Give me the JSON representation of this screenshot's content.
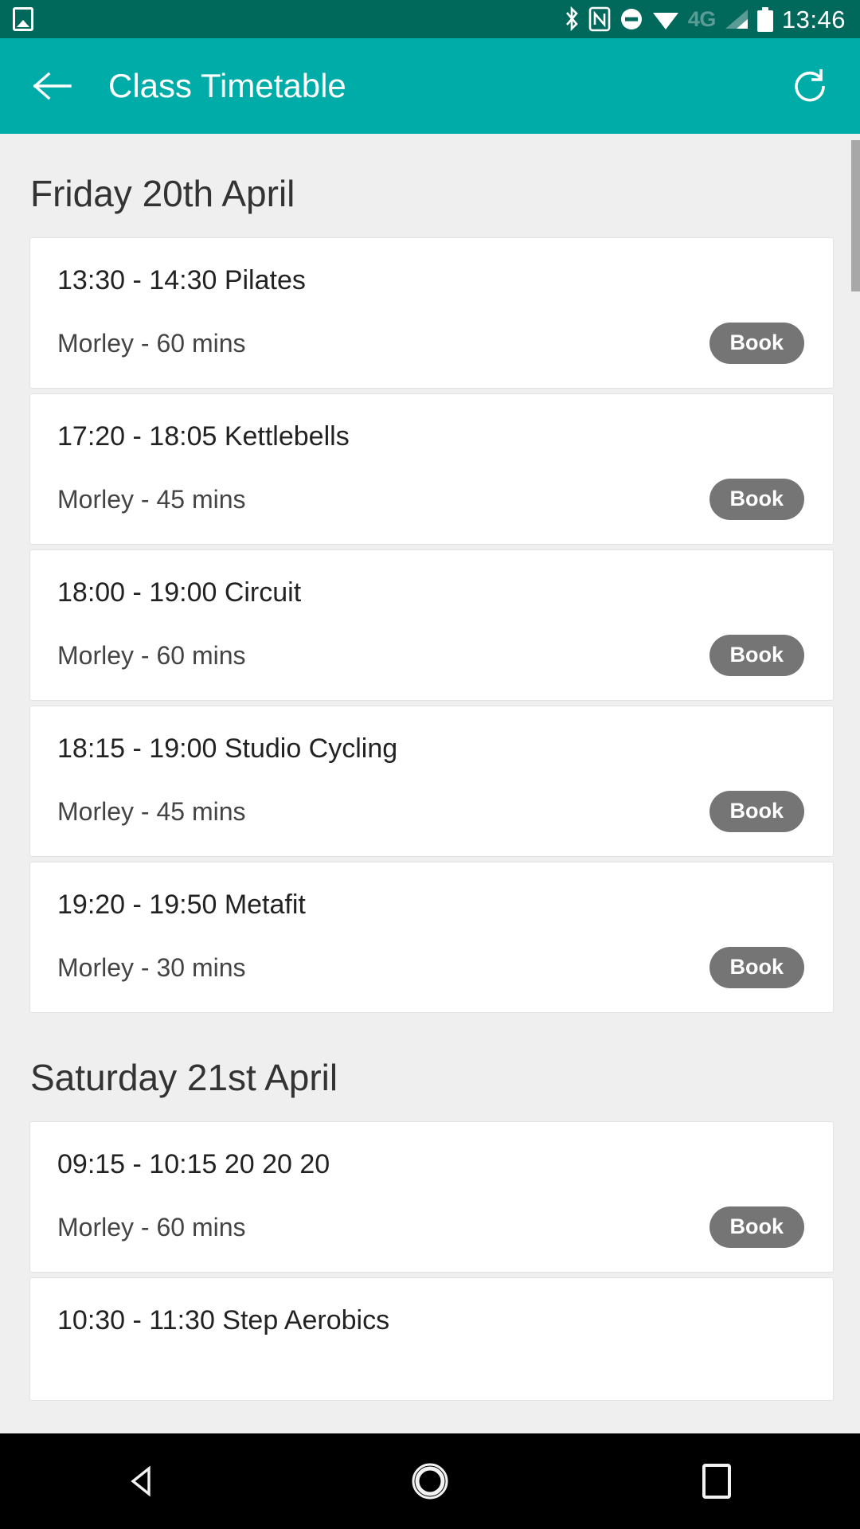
{
  "status_bar": {
    "background": "#00695C",
    "left_icons": [
      "photo-icon"
    ],
    "right_icons": [
      "bluetooth-icon",
      "nfc-icon",
      "do-not-disturb-icon",
      "wifi-icon"
    ],
    "network_label": "4G",
    "time": "13:46"
  },
  "app_bar": {
    "background": "#00ACA7",
    "back_label": "Back",
    "title": "Class Timetable",
    "refresh_label": "Refresh"
  },
  "book_button_color": "#757575",
  "sections": [
    {
      "date": "Friday 20th April",
      "classes": [
        {
          "title": "13:30 - 14:30 Pilates",
          "subtitle": "Morley - 60 mins",
          "action": "Book"
        },
        {
          "title": "17:20 - 18:05 Kettlebells",
          "subtitle": "Morley - 45 mins",
          "action": "Book"
        },
        {
          "title": "18:00 - 19:00 Circuit",
          "subtitle": "Morley - 60 mins",
          "action": "Book"
        },
        {
          "title": "18:15 - 19:00 Studio Cycling",
          "subtitle": "Morley - 45 mins",
          "action": "Book"
        },
        {
          "title": "19:20 - 19:50 Metafit",
          "subtitle": "Morley - 30 mins",
          "action": "Book"
        }
      ]
    },
    {
      "date": "Saturday 21st April",
      "classes": [
        {
          "title": "09:15 - 10:15 20 20 20",
          "subtitle": "Morley - 60 mins",
          "action": "Book"
        },
        {
          "title": "10:30 - 11:30 Step Aerobics",
          "subtitle": "",
          "action": ""
        }
      ]
    }
  ],
  "nav_bar": {
    "back_label": "Back",
    "home_label": "Home",
    "recents_label": "Recents"
  }
}
